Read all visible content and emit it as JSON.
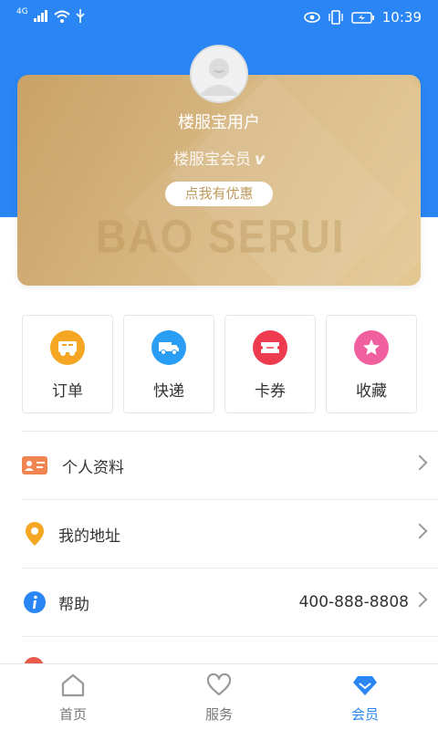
{
  "status_bar": {
    "network": "4G",
    "time": "10:39"
  },
  "profile": {
    "username": "楼服宝用户",
    "member_level": "楼服宝会员",
    "member_badge": "v",
    "discount_button": "点我有优惠",
    "watermark": "BAO SERUI"
  },
  "quick_actions": [
    {
      "label": "订单",
      "icon": "order-icon",
      "color": "#f5a623"
    },
    {
      "label": "快递",
      "icon": "delivery-truck-icon",
      "color": "#2a9df4"
    },
    {
      "label": "卡券",
      "icon": "coupon-icon",
      "color": "#ee3b4f"
    },
    {
      "label": "收藏",
      "icon": "star-icon",
      "color": "#f0609e"
    }
  ],
  "menu": [
    {
      "label": "个人资料",
      "icon": "id-card-icon",
      "value": ""
    },
    {
      "label": "我的地址",
      "icon": "location-pin-icon",
      "value": ""
    },
    {
      "label": "帮助",
      "icon": "info-icon",
      "value": "400-888-8808"
    }
  ],
  "tab_bar": [
    {
      "label": "首页",
      "icon": "home-icon",
      "active": false
    },
    {
      "label": "服务",
      "icon": "heart-icon",
      "active": false
    },
    {
      "label": "会员",
      "icon": "diamond-icon",
      "active": true
    }
  ],
  "colors": {
    "primary": "#2a86f5",
    "card_gold": "#d6b57f"
  }
}
